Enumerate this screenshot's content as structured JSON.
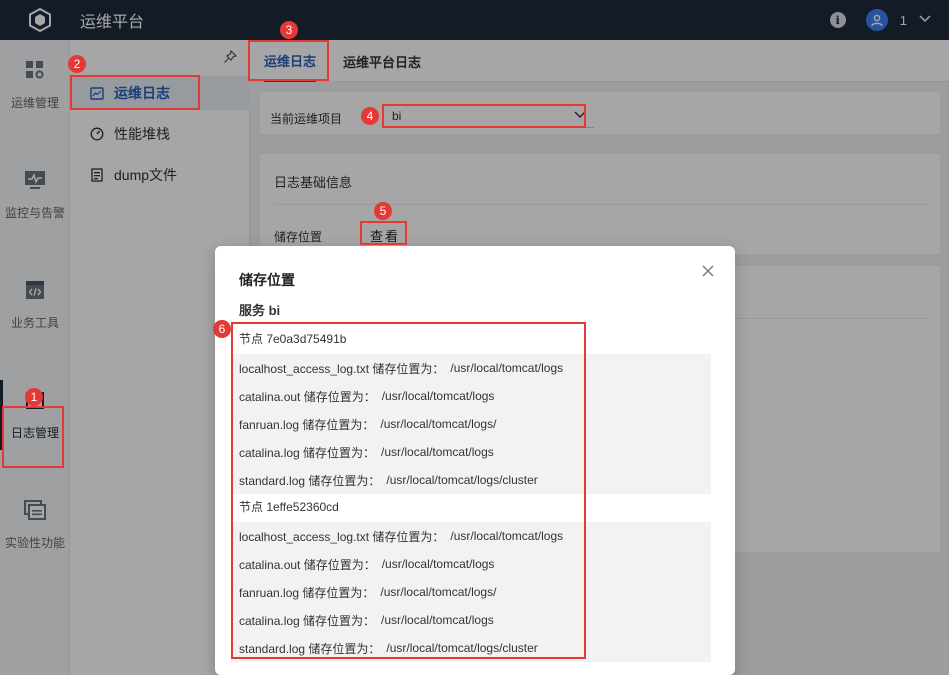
{
  "app": {
    "title": "运维平台"
  },
  "user": {
    "name": "1"
  },
  "nav": {
    "items": [
      {
        "label": "运维管理"
      },
      {
        "label": "监控与告警"
      },
      {
        "label": "业务工具"
      },
      {
        "label": "日志管理"
      },
      {
        "label": "实验性功能"
      }
    ]
  },
  "submenu": {
    "items": [
      {
        "label": "运维日志"
      },
      {
        "label": "性能堆栈"
      },
      {
        "label": "dump文件"
      }
    ]
  },
  "tabs": [
    {
      "label": "运维日志"
    },
    {
      "label": "运维平台日志"
    }
  ],
  "main": {
    "project_label": "当前运维项目",
    "project_value": "bi",
    "basic_info_title": "日志基础信息",
    "storage_label": "储存位置",
    "view_button": "查看"
  },
  "modal": {
    "title": "储存位置",
    "service": "服务 bi",
    "nodes": [
      {
        "title": "节点 7e0a3d75491b",
        "logs": [
          {
            "name": "localhost_access_log.txt 储存位置为：",
            "path": "/usr/local/tomcat/logs"
          },
          {
            "name": "catalina.out 储存位置为：",
            "path": "/usr/local/tomcat/logs"
          },
          {
            "name": "fanruan.log 储存位置为：",
            "path": "/usr/local/tomcat/logs/"
          },
          {
            "name": "catalina.log 储存位置为：",
            "path": "/usr/local/tomcat/logs"
          },
          {
            "name": "standard.log 储存位置为：",
            "path": "/usr/local/tomcat/logs/cluster"
          }
        ]
      },
      {
        "title": "节点 1effe52360cd",
        "logs": [
          {
            "name": "localhost_access_log.txt 储存位置为：",
            "path": "/usr/local/tomcat/logs"
          },
          {
            "name": "catalina.out 储存位置为：",
            "path": "/usr/local/tomcat/logs"
          },
          {
            "name": "fanruan.log 储存位置为：",
            "path": "/usr/local/tomcat/logs/"
          },
          {
            "name": "catalina.log 储存位置为：",
            "path": "/usr/local/tomcat/logs"
          },
          {
            "name": "standard.log 储存位置为：",
            "path": "/usr/local/tomcat/logs/cluster"
          }
        ]
      }
    ]
  },
  "annotations": [
    "1",
    "2",
    "3",
    "4",
    "5",
    "6"
  ],
  "colors": {
    "accent": "#2b5fb8",
    "topbar": "#1e2a3d",
    "annotation": "#e53935"
  }
}
